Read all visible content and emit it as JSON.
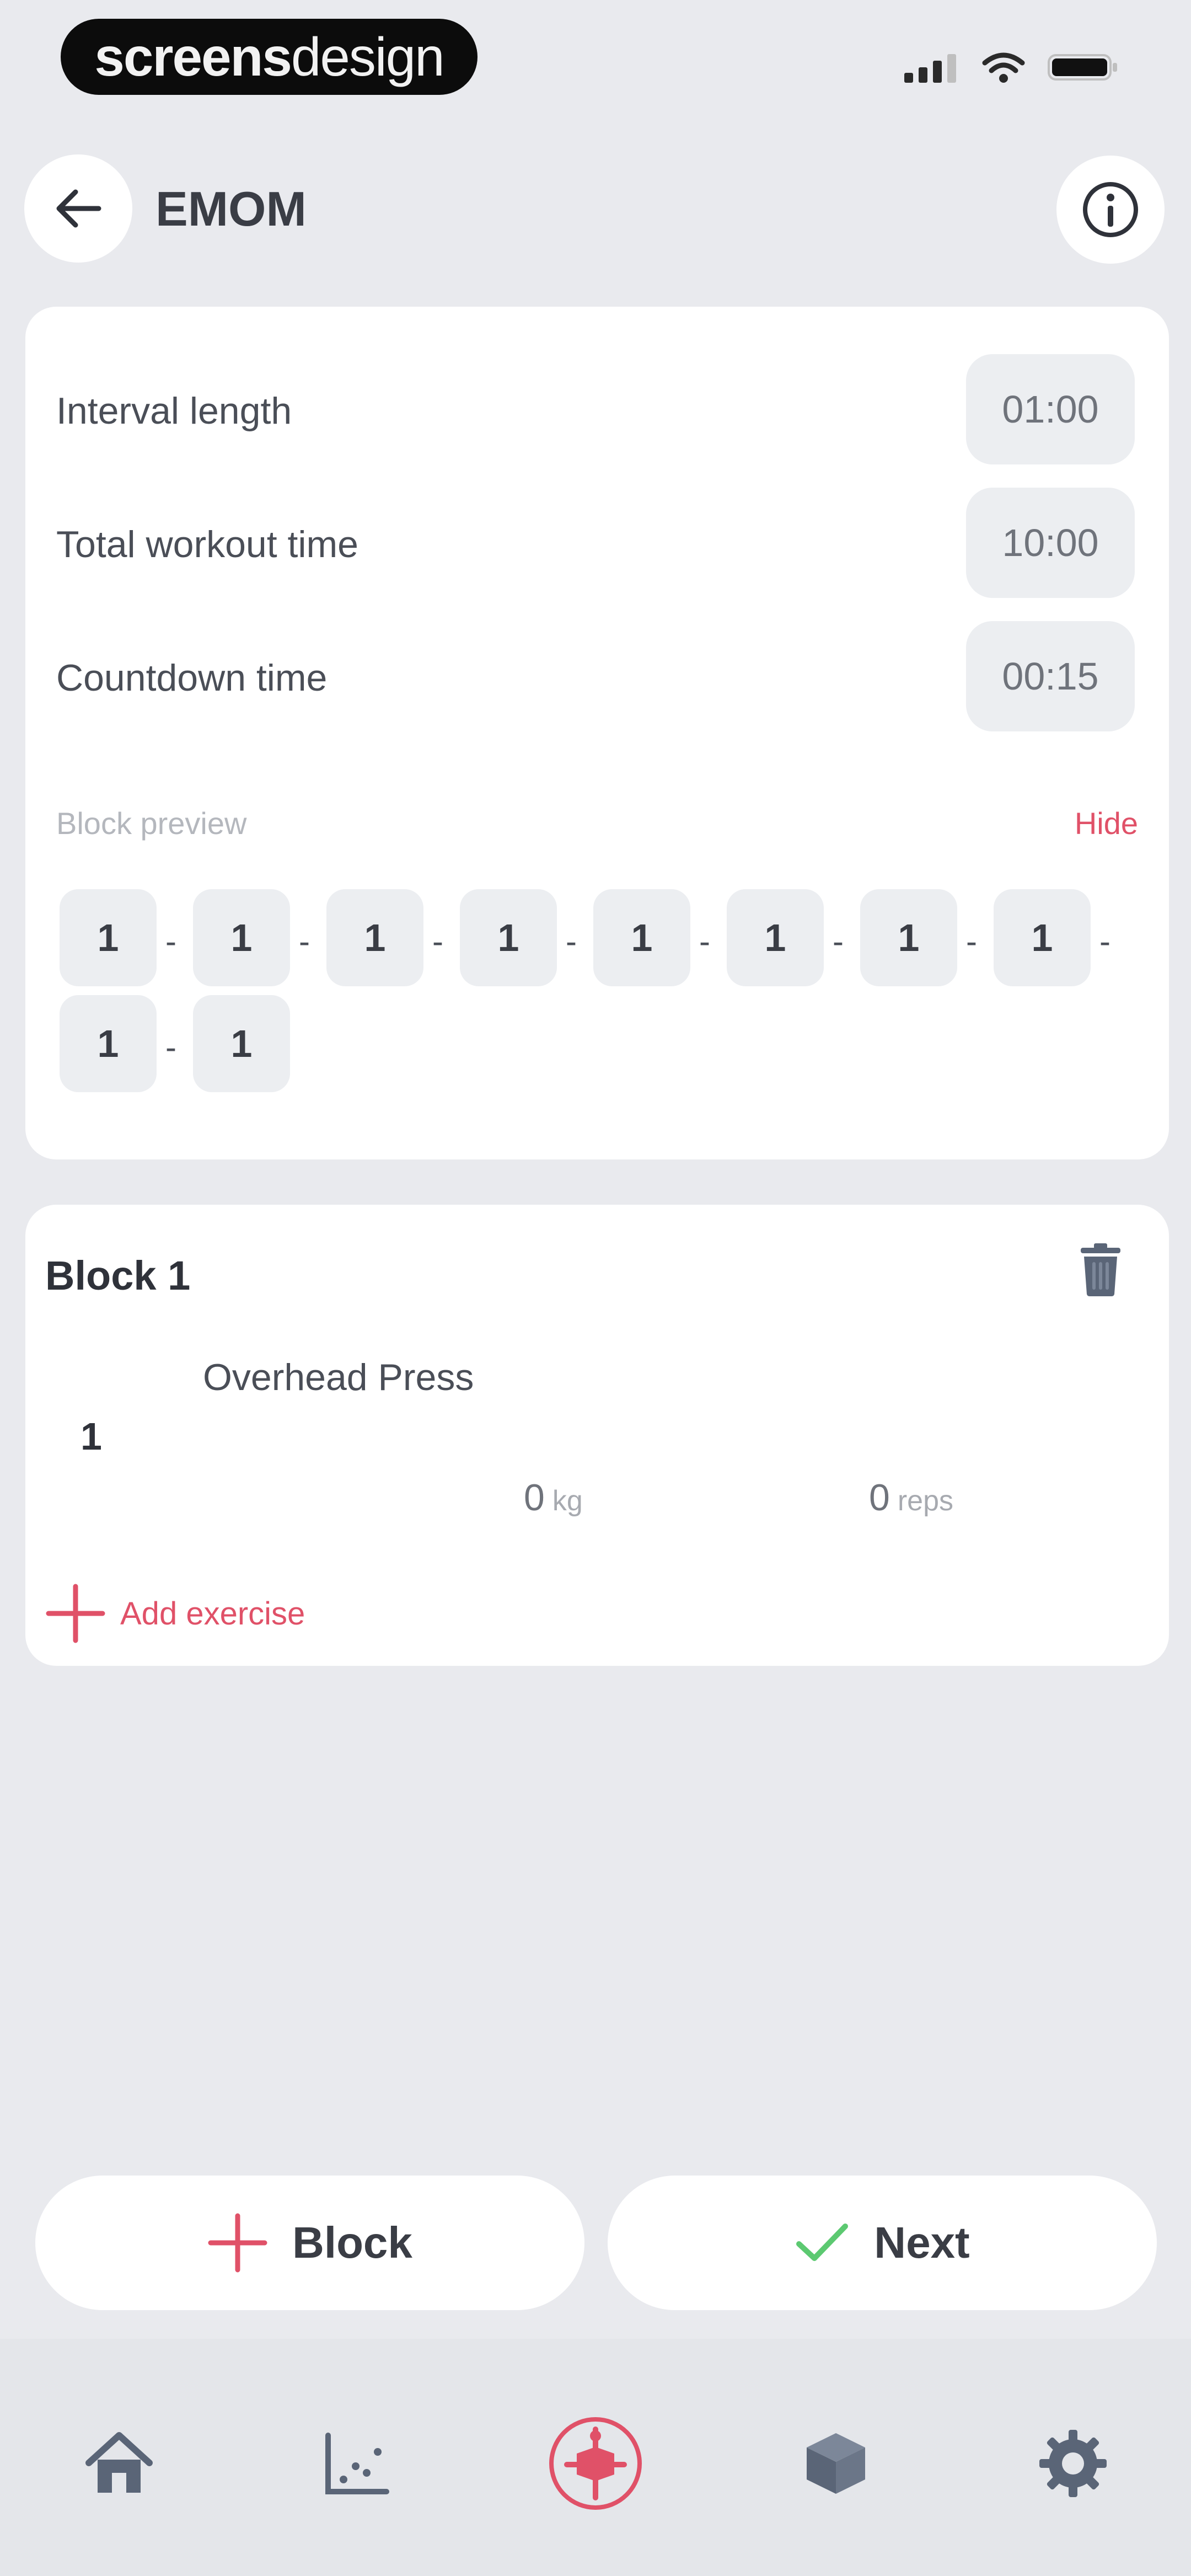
{
  "status_bar": {
    "brand_bold": "screens",
    "brand_light": "design"
  },
  "header": {
    "title": "EMOM"
  },
  "settings": [
    {
      "label": "Interval length",
      "value": "01:00"
    },
    {
      "label": "Total workout time",
      "value": "10:00"
    },
    {
      "label": "Countdown time",
      "value": "00:15"
    }
  ],
  "preview": {
    "label": "Block preview",
    "hide_label": "Hide",
    "blocks": [
      "1",
      "1",
      "1",
      "1",
      "1",
      "1",
      "1",
      "1",
      "1",
      "1"
    ],
    "separator": "-"
  },
  "block": {
    "title": "Block 1",
    "exercise": {
      "name": "Overhead Press",
      "set_number": "1",
      "weight_value": "0",
      "weight_unit": "kg",
      "reps_value": "0",
      "reps_unit": "reps"
    },
    "add_exercise_label": "Add exercise"
  },
  "actions": {
    "block_label": "Block",
    "next_label": "Next"
  },
  "nav": {
    "items": [
      "home-icon",
      "stats-chart-icon",
      "workout-icon",
      "library-box-icon",
      "settings-gear-icon"
    ],
    "active_index": 2
  },
  "colors": {
    "accent": "#e05168",
    "check": "#5cc971",
    "background": "#e9eaee",
    "card": "#ffffff"
  }
}
